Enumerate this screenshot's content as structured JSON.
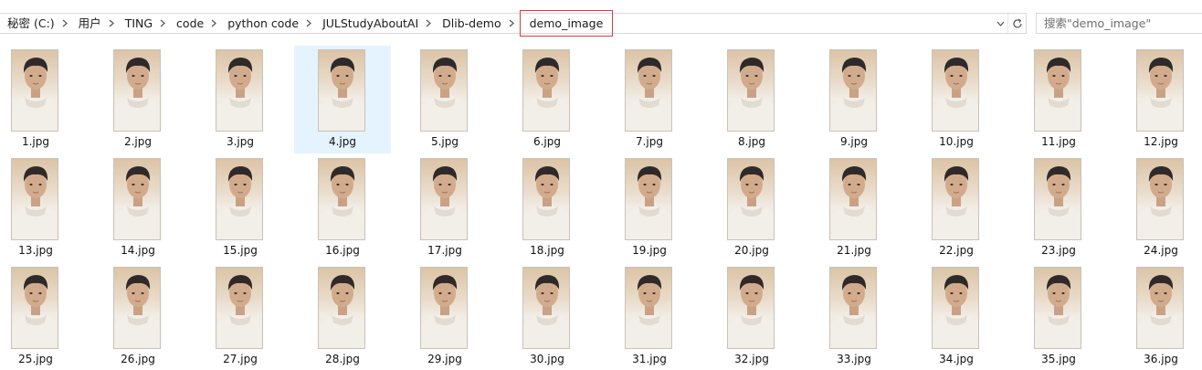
{
  "breadcrumb": {
    "items": [
      "秘密 (C:)",
      "用户",
      "TING",
      "code",
      "python code",
      "JULStudyAboutAI",
      "Dlib-demo",
      "demo_image"
    ]
  },
  "search": {
    "placeholder": "搜索\"demo_image\""
  },
  "icons": {
    "separator": "chevron-right-icon",
    "dropdown": "chevron-down-icon",
    "refresh": "refresh-icon"
  },
  "colors": {
    "selection": "#e5f3ff",
    "current_highlight": "#e0393e"
  },
  "files": [
    {
      "name": "1.jpg"
    },
    {
      "name": "2.jpg"
    },
    {
      "name": "3.jpg"
    },
    {
      "name": "4.jpg",
      "selected": true
    },
    {
      "name": "5.jpg"
    },
    {
      "name": "6.jpg"
    },
    {
      "name": "7.jpg"
    },
    {
      "name": "8.jpg"
    },
    {
      "name": "9.jpg"
    },
    {
      "name": "10.jpg"
    },
    {
      "name": "11.jpg"
    },
    {
      "name": "12.jpg"
    },
    {
      "name": "13.jpg"
    },
    {
      "name": "14.jpg"
    },
    {
      "name": "15.jpg"
    },
    {
      "name": "16.jpg"
    },
    {
      "name": "17.jpg"
    },
    {
      "name": "18.jpg"
    },
    {
      "name": "19.jpg"
    },
    {
      "name": "20.jpg"
    },
    {
      "name": "21.jpg"
    },
    {
      "name": "22.jpg"
    },
    {
      "name": "23.jpg"
    },
    {
      "name": "24.jpg"
    },
    {
      "name": "25.jpg"
    },
    {
      "name": "26.jpg"
    },
    {
      "name": "27.jpg"
    },
    {
      "name": "28.jpg"
    },
    {
      "name": "29.jpg"
    },
    {
      "name": "30.jpg"
    },
    {
      "name": "31.jpg"
    },
    {
      "name": "32.jpg"
    },
    {
      "name": "33.jpg"
    },
    {
      "name": "34.jpg"
    },
    {
      "name": "35.jpg"
    },
    {
      "name": "36.jpg"
    }
  ]
}
